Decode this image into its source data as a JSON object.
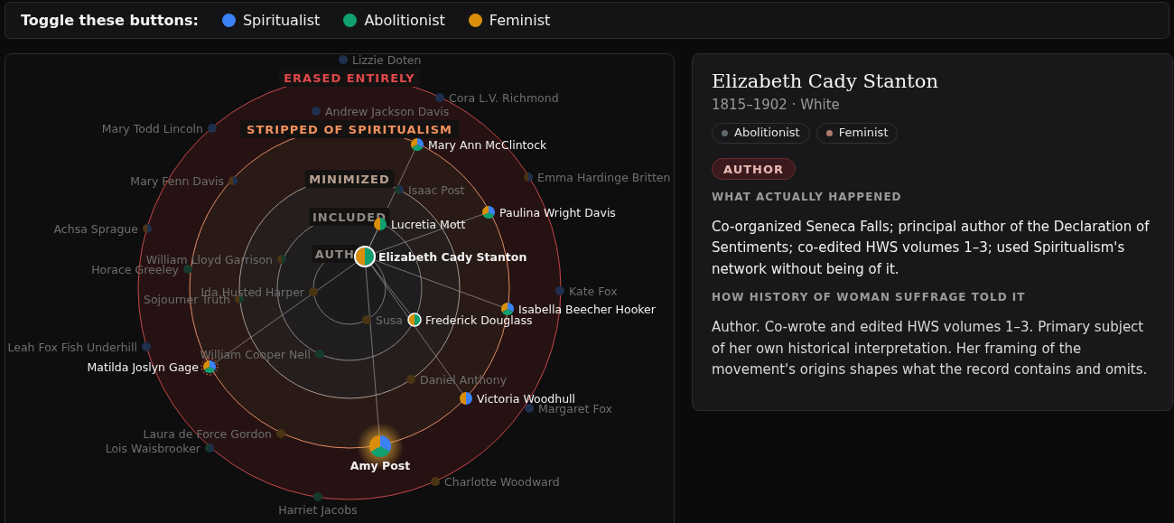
{
  "toggle_bar": {
    "label": "Toggle these buttons:",
    "toggles": [
      {
        "label": "Spiritualist",
        "color": "#3b82f6",
        "on": true
      },
      {
        "label": "Abolitionist",
        "color": "#10a070",
        "on": true
      },
      {
        "label": "Feminist",
        "color": "#d98e0b",
        "on": true
      }
    ]
  },
  "diagram": {
    "bands": [
      {
        "label": "ERASED ENTIRELY",
        "color": "#e0484b"
      },
      {
        "label": "STRIPPED OF SPIRITUALISM",
        "color": "#f0905e"
      },
      {
        "label": "MINIMIZED",
        "color": "#b8a090"
      },
      {
        "label": "INCLUDED",
        "color": "#8f8a84"
      },
      {
        "label": "AUTH",
        "color": "#8f8a84"
      }
    ],
    "nodes": [
      {
        "label": "Lizzie Doten",
        "kind": "faded",
        "slices": [
          {
            "color": "#1f2f4d"
          }
        ]
      },
      {
        "label": "Cora L.V. Richmond",
        "kind": "faded",
        "slices": [
          {
            "color": "#1f2f4d"
          }
        ]
      },
      {
        "label": "Andrew Jackson Davis",
        "kind": "faded",
        "slices": [
          {
            "color": "#1f2f4d"
          }
        ]
      },
      {
        "label": "Mary Todd Lincoln",
        "kind": "faded",
        "slices": [
          {
            "color": "#1f2f4d"
          }
        ]
      },
      {
        "label": "Mary Ann McClintock",
        "kind": "plain",
        "slices": [
          {
            "color": "#3b82f6"
          },
          {
            "color": "#10a070"
          },
          {
            "color": "#d98e0b"
          }
        ]
      },
      {
        "label": "Mary Fenn Davis",
        "kind": "faded",
        "slices": [
          {
            "color": "#1f2f4d"
          },
          {
            "color": "#4a3414"
          }
        ]
      },
      {
        "label": "Emma Hardinge Britten",
        "kind": "faded",
        "slices": [
          {
            "color": "#1f2f4d"
          },
          {
            "color": "#4a3414"
          }
        ]
      },
      {
        "label": "Isaac Post",
        "kind": "faded",
        "slices": [
          {
            "color": "#1f2f4d"
          },
          {
            "color": "#163a2c"
          }
        ]
      },
      {
        "label": "Paulina Wright Davis",
        "kind": "plain",
        "slices": [
          {
            "color": "#3b82f6"
          },
          {
            "color": "#10a070"
          },
          {
            "color": "#d98e0b"
          }
        ]
      },
      {
        "label": "Achsa Sprague",
        "kind": "faded",
        "slices": [
          {
            "color": "#1f2f4d"
          },
          {
            "color": "#4a3414"
          }
        ]
      },
      {
        "label": "Lucretia Mott",
        "kind": "plain",
        "slices": [
          {
            "color": "#10a070"
          },
          {
            "color": "#d98e0b"
          }
        ]
      },
      {
        "label": "William Lloyd Garrison",
        "kind": "faded",
        "slices": [
          {
            "color": "#163a2c"
          },
          {
            "color": "#4a3414"
          }
        ]
      },
      {
        "label": "Elizabeth Cady Stanton",
        "kind": "selected",
        "slices": [
          {
            "color": "#10a070"
          },
          {
            "color": "#d98e0b"
          }
        ]
      },
      {
        "label": "Horace Greeley",
        "kind": "faded",
        "slices": [
          {
            "color": "#163a2c"
          }
        ]
      },
      {
        "label": "Sojourner Truth",
        "kind": "faded",
        "slices": [
          {
            "color": "#163a2c"
          },
          {
            "color": "#4a3414"
          }
        ]
      },
      {
        "label": "Ida Husted Harper",
        "kind": "faded",
        "slices": [
          {
            "color": "#4a3414"
          }
        ]
      },
      {
        "label": "Kate Fox",
        "kind": "faded",
        "slices": [
          {
            "color": "#1f2f4d"
          }
        ]
      },
      {
        "label": "Isabella Beecher Hooker",
        "kind": "plain",
        "slices": [
          {
            "color": "#3b82f6"
          },
          {
            "color": "#10a070"
          },
          {
            "color": "#d98e0b"
          }
        ]
      },
      {
        "label": "Susa",
        "kind": "faded",
        "slices": [
          {
            "color": "#4a3414"
          }
        ]
      },
      {
        "label": "Frederick Douglass",
        "kind": "ringed",
        "slices": [
          {
            "color": "#10a070"
          },
          {
            "color": "#d98e0b"
          }
        ]
      },
      {
        "label": "Leah Fox Fish Underhill",
        "kind": "faded",
        "slices": [
          {
            "color": "#1f2f4d"
          }
        ]
      },
      {
        "label": "William Cooper Nell",
        "kind": "faded",
        "slices": [
          {
            "color": "#163a2c"
          }
        ]
      },
      {
        "label": "Matilda Joslyn Gage",
        "kind": "dashed",
        "slices": [
          {
            "color": "#3b82f6"
          },
          {
            "color": "#10a070"
          },
          {
            "color": "#d98e0b"
          }
        ]
      },
      {
        "label": "Daniel Anthony",
        "kind": "faded",
        "slices": [
          {
            "color": "#4a3414"
          }
        ]
      },
      {
        "label": "Victoria Woodhull",
        "kind": "plain",
        "slices": [
          {
            "color": "#3b82f6"
          },
          {
            "color": "#d98e0b"
          }
        ]
      },
      {
        "label": "Margaret Fox",
        "kind": "faded",
        "slices": [
          {
            "color": "#1f2f4d"
          }
        ]
      },
      {
        "label": "Laura de Force Gordon",
        "kind": "faded",
        "slices": [
          {
            "color": "#4a3414"
          }
        ]
      },
      {
        "label": "Lois Waisbrooker",
        "kind": "faded",
        "slices": [
          {
            "color": "#1f2f4d"
          },
          {
            "color": "#163a2c"
          }
        ]
      },
      {
        "label": "Amy Post",
        "kind": "glowing",
        "slices": [
          {
            "color": "#3b82f6"
          },
          {
            "color": "#10a070"
          },
          {
            "color": "#d98e0b"
          }
        ]
      },
      {
        "label": "Charlotte Woodward",
        "kind": "faded",
        "slices": [
          {
            "color": "#4a3414"
          }
        ]
      },
      {
        "label": "Harriet Jacobs",
        "kind": "faded",
        "slices": [
          {
            "color": "#163a2c"
          }
        ]
      }
    ]
  },
  "details": {
    "name": "Elizabeth Cady Stanton",
    "meta": "1815–1902 · White",
    "tags": [
      {
        "label": "Abolitionist",
        "color": "#5f6b6b"
      },
      {
        "label": "Feminist",
        "color": "#b07a6a"
      }
    ],
    "badge": "AUTHOR",
    "sections": [
      {
        "heading": "WHAT ACTUALLY HAPPENED",
        "text": "Co-organized Seneca Falls; principal author of the Declaration of Sentiments; co-edited HWS volumes 1–3; used Spiritualism's network without being of it."
      },
      {
        "heading": "HOW HISTORY OF WOMAN SUFFRAGE TOLD IT",
        "text": "Author. Co-wrote and edited HWS volumes 1–3. Primary subject of her own historical interpretation. Her framing of the movement's origins shapes what the record contains and omits."
      }
    ]
  }
}
